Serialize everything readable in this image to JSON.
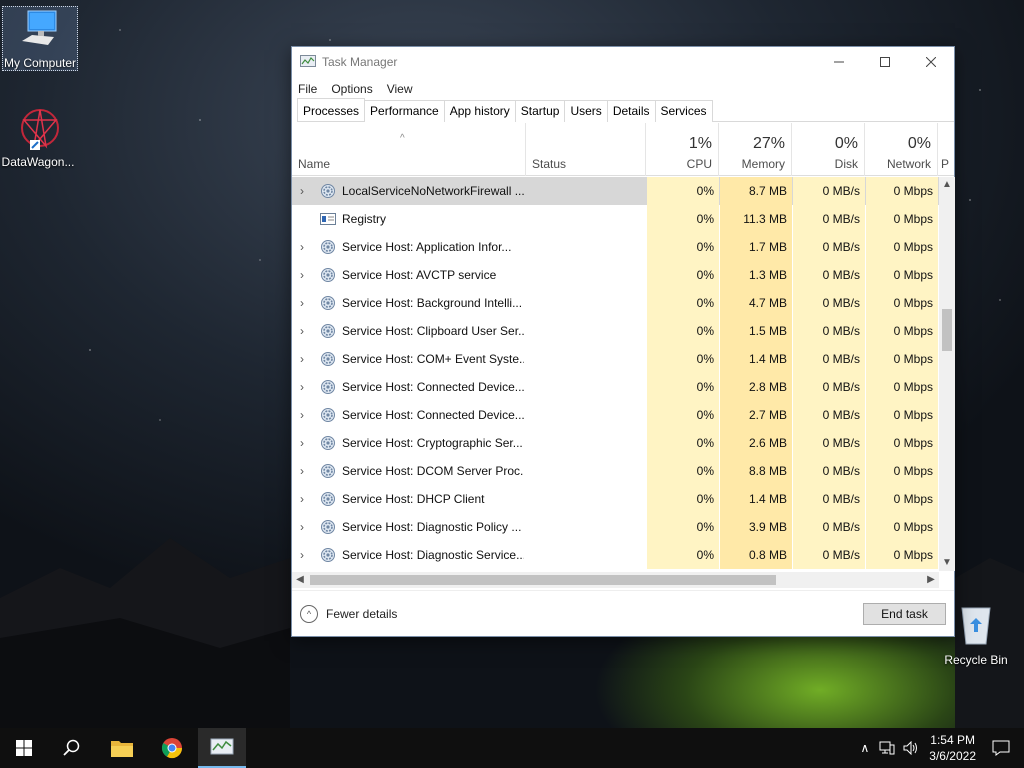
{
  "desktop": {
    "icons": [
      {
        "label": "My Computer"
      },
      {
        "label": "DataWagon..."
      },
      {
        "label": "Recycle Bin"
      }
    ]
  },
  "window": {
    "title": "Task Manager",
    "menu": [
      "File",
      "Options",
      "View"
    ],
    "tabs": [
      "Processes",
      "Performance",
      "App history",
      "Startup",
      "Users",
      "Details",
      "Services"
    ],
    "columns": {
      "name": "Name",
      "status": "Status",
      "cpu": {
        "pct": "1%",
        "label": "CPU"
      },
      "memory": {
        "pct": "27%",
        "label": "Memory"
      },
      "disk": {
        "pct": "0%",
        "label": "Disk"
      },
      "network": {
        "pct": "0%",
        "label": "Network"
      },
      "next_partial": "P"
    },
    "rows": [
      {
        "name": "LocalServiceNoNetworkFirewall ...",
        "cpu": "0%",
        "mem": "8.7 MB",
        "disk": "0 MB/s",
        "net": "0 Mbps",
        "expand": true,
        "icon": "gear-icon"
      },
      {
        "name": "Registry",
        "cpu": "0%",
        "mem": "11.3 MB",
        "disk": "0 MB/s",
        "net": "0 Mbps",
        "expand": false,
        "icon": "registry-icon"
      },
      {
        "name": "Service Host: Application Infor...",
        "cpu": "0%",
        "mem": "1.7 MB",
        "disk": "0 MB/s",
        "net": "0 Mbps",
        "expand": true,
        "icon": "gear-icon"
      },
      {
        "name": "Service Host: AVCTP service",
        "cpu": "0%",
        "mem": "1.3 MB",
        "disk": "0 MB/s",
        "net": "0 Mbps",
        "expand": true,
        "icon": "gear-icon"
      },
      {
        "name": "Service Host: Background Intelli...",
        "cpu": "0%",
        "mem": "4.7 MB",
        "disk": "0 MB/s",
        "net": "0 Mbps",
        "expand": true,
        "icon": "gear-icon"
      },
      {
        "name": "Service Host: Clipboard User Ser...",
        "cpu": "0%",
        "mem": "1.5 MB",
        "disk": "0 MB/s",
        "net": "0 Mbps",
        "expand": true,
        "icon": "gear-icon"
      },
      {
        "name": "Service Host: COM+ Event Syste...",
        "cpu": "0%",
        "mem": "1.4 MB",
        "disk": "0 MB/s",
        "net": "0 Mbps",
        "expand": true,
        "icon": "gear-icon"
      },
      {
        "name": "Service Host: Connected Device...",
        "cpu": "0%",
        "mem": "2.8 MB",
        "disk": "0 MB/s",
        "net": "0 Mbps",
        "expand": true,
        "icon": "gear-icon"
      },
      {
        "name": "Service Host: Connected Device...",
        "cpu": "0%",
        "mem": "2.7 MB",
        "disk": "0 MB/s",
        "net": "0 Mbps",
        "expand": true,
        "icon": "gear-icon"
      },
      {
        "name": "Service Host: Cryptographic Ser...",
        "cpu": "0%",
        "mem": "2.6 MB",
        "disk": "0 MB/s",
        "net": "0 Mbps",
        "expand": true,
        "icon": "gear-icon"
      },
      {
        "name": "Service Host: DCOM Server Proc...",
        "cpu": "0%",
        "mem": "8.8 MB",
        "disk": "0 MB/s",
        "net": "0 Mbps",
        "expand": true,
        "icon": "gear-icon"
      },
      {
        "name": "Service Host: DHCP Client",
        "cpu": "0%",
        "mem": "1.4 MB",
        "disk": "0 MB/s",
        "net": "0 Mbps",
        "expand": true,
        "icon": "gear-icon"
      },
      {
        "name": "Service Host: Diagnostic Policy ...",
        "cpu": "0%",
        "mem": "3.9 MB",
        "disk": "0 MB/s",
        "net": "0 Mbps",
        "expand": true,
        "icon": "gear-icon"
      },
      {
        "name": "Service Host: Diagnostic Service...",
        "cpu": "0%",
        "mem": "0.8 MB",
        "disk": "0 MB/s",
        "net": "0 Mbps",
        "expand": true,
        "icon": "gear-icon"
      }
    ],
    "footer": {
      "fewer_details": "Fewer details",
      "end_task": "End task"
    }
  },
  "taskbar": {
    "time": "1:54 PM",
    "date": "3/6/2022"
  },
  "colors": {
    "cpu_bg": "#fff4c4",
    "memory_bg": "#ffe9a8",
    "selected_row": "#d7d7d7",
    "taskbar": "#0f0f0f"
  }
}
